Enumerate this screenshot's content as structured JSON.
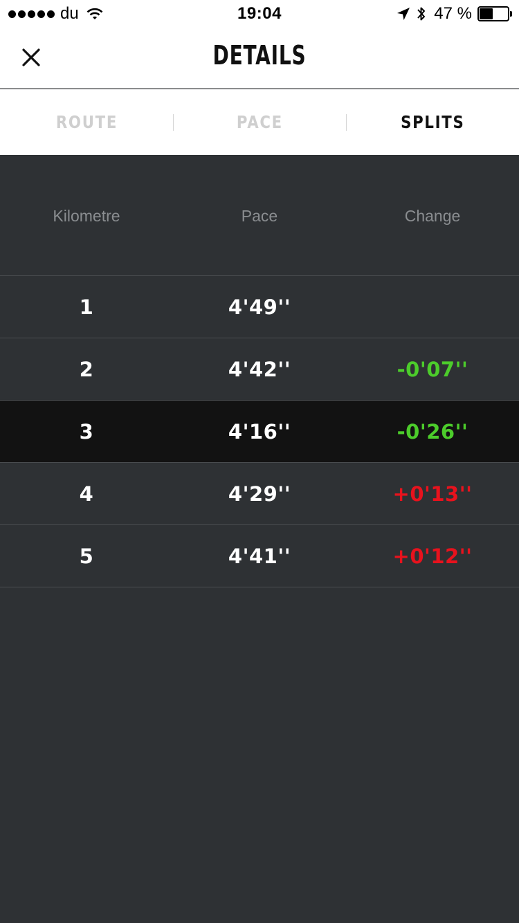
{
  "status_bar": {
    "carrier": "du",
    "time": "19:04",
    "battery_percent": "47 %",
    "battery_level": 0.47,
    "icons": [
      "signal-dots",
      "wifi-icon",
      "location-arrow-icon",
      "bluetooth-icon",
      "battery-icon"
    ]
  },
  "nav": {
    "title": "DETAILS",
    "close_icon": "close-icon"
  },
  "tabs": [
    {
      "label": "ROUTE",
      "active": false
    },
    {
      "label": "PACE",
      "active": false
    },
    {
      "label": "SPLITS",
      "active": true
    }
  ],
  "table": {
    "headers": [
      "Kilometre",
      "Pace",
      "Change"
    ],
    "rows": [
      {
        "km": "1",
        "pace": "4'49''",
        "change": "",
        "change_type": "none",
        "highlight": false
      },
      {
        "km": "2",
        "pace": "4'42''",
        "change": "-0'07''",
        "change_type": "faster",
        "highlight": false
      },
      {
        "km": "3",
        "pace": "4'16''",
        "change": "-0'26''",
        "change_type": "faster",
        "highlight": true
      },
      {
        "km": "4",
        "pace": "4'29''",
        "change": "+0'13''",
        "change_type": "slower",
        "highlight": false
      },
      {
        "km": "5",
        "pace": "4'41''",
        "change": "+0'12''",
        "change_type": "slower",
        "highlight": false
      }
    ]
  },
  "colors": {
    "background": "#2e3134",
    "highlight_row": "#121212",
    "faster": "#4ccc2b",
    "slower": "#e8121d",
    "header_text": "#8a8d90"
  }
}
